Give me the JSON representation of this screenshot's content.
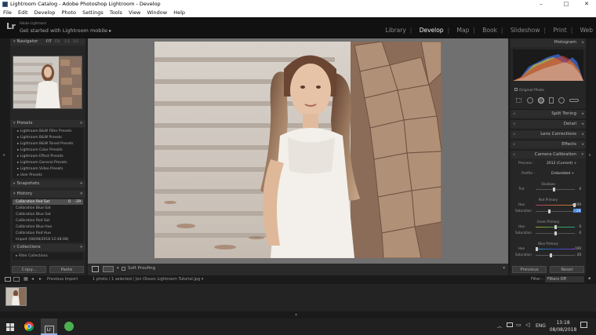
{
  "window": {
    "title": "Lightroom Catalog - Adobe Photoshop Lightroom - Develop",
    "controls": [
      "–",
      "□",
      "✕"
    ]
  },
  "menu": [
    "File",
    "Edit",
    "Develop",
    "Photo",
    "Settings",
    "Tools",
    "View",
    "Window",
    "Help"
  ],
  "header": {
    "logo": "Lr",
    "brand": "Adobe Lightroom",
    "mobile_link": "Get started with Lightroom mobile ▸",
    "modules": [
      "Library",
      "Develop",
      "Map",
      "Book",
      "Slideshow",
      "Print",
      "Web"
    ],
    "active_module": "Develop"
  },
  "left_panel": {
    "navigator": {
      "title": "Navigator",
      "zoom_options": [
        "FIT",
        "Fill",
        "1:1",
        "3:1"
      ]
    },
    "presets": {
      "title": "Presets",
      "items": [
        "Lightroom B&W Filter Presets",
        "Lightroom B&W Presets",
        "Lightroom B&W Toned Presets",
        "Lightroom Color Presets",
        "Lightroom Effect Presets",
        "Lightroom General Presets",
        "Lightroom Video Presets",
        "User Presets"
      ]
    },
    "snapshots": {
      "title": "Snapshots"
    },
    "history": {
      "title": "History",
      "items": [
        {
          "label": "Calibration Red Sat",
          "a": "0",
          "b": "-29"
        },
        {
          "label": "Calibration Blue Sat",
          "a": "",
          "b": ""
        },
        {
          "label": "Calibration Blue Sat",
          "a": "",
          "b": ""
        },
        {
          "label": "Calibration Red Sat",
          "a": "",
          "b": ""
        },
        {
          "label": "Calibration Blue Hue",
          "a": "",
          "b": ""
        },
        {
          "label": "Calibration Red Hue",
          "a": "",
          "b": ""
        },
        {
          "label": "Import (08/08/2018 12:48:08)",
          "a": "",
          "b": ""
        }
      ]
    },
    "collections": {
      "title": "Collections",
      "filter": "Filter Collections"
    },
    "copy_button": "Copy...",
    "paste_button": "Paste"
  },
  "toolbar": {
    "soft_proofing": "Soft Proofing"
  },
  "right_panel": {
    "histogram": {
      "title": "Histogram",
      "original_photo": "Original Photo"
    },
    "sections": [
      "Split Toning",
      "Detail",
      "Lens Corrections",
      "Effects",
      "Camera Calibration"
    ],
    "calibration": {
      "process_label": "Process :",
      "process_value": "2012 (Current) ÷",
      "profile_label": "Profile :",
      "profile_value": "Embedded ÷",
      "shadows_label": "Shadows",
      "tint_label": "Tint",
      "tint_value": "0",
      "red_primary": "Red Primary",
      "red_hue_label": "Hue",
      "red_hue_value": "+ 100",
      "red_sat_label": "Saturation",
      "red_sat_value": "- 29",
      "green_primary": "Green Primary",
      "green_hue_label": "Hue",
      "green_hue_value": "0",
      "green_sat_label": "Saturation",
      "green_sat_value": "0",
      "blue_primary": "Blue Primary",
      "blue_hue_label": "Hue",
      "blue_hue_value": "- 100",
      "blue_sat_label": "Saturation",
      "blue_sat_value": "- 20"
    },
    "previous_button": "Previous",
    "reset_button": "Reset"
  },
  "filmstrip": {
    "source": "Previous Import",
    "info": "1 photo / 1 selected / Jon Olsson Lightroom Tutorial.jpg ▾",
    "filter_label": "Filter :",
    "filter_value": "Filters Off"
  },
  "taskbar": {
    "lang": "ENG",
    "time": "13:18",
    "date": "08/08/2018"
  }
}
